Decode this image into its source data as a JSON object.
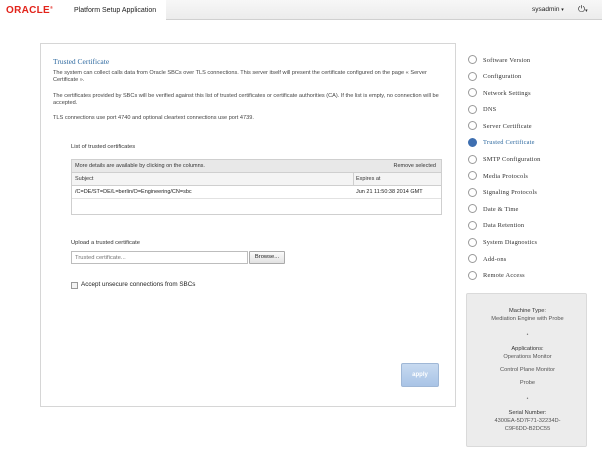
{
  "header": {
    "logo": "ORACLE",
    "logo_mark": "®",
    "app_title": "Platform Setup Application",
    "user": "sysadmin",
    "user_caret": "▾",
    "power_icon": "⏻",
    "power_caret": "▾"
  },
  "panel": {
    "title": "Trusted Certificate",
    "para1": "The system can collect calls data from Oracle SBCs over TLS connections. This server itself will present the certificate configured on the page « Server Certificate ».",
    "para2": "The certificates provided by SBCs will be verified against this list of trusted certificates or certificate authorities (CA). If the list is empty, no connection will be accepted.",
    "para3": "TLS connections use port 4740 and optional cleartext connections use port 4739.",
    "list_label": "List of trusted certificates",
    "table": {
      "hint": "More details are available by clicking on the columns.",
      "remove_label": "Remove selected",
      "columns": [
        "Subject",
        "Expires at"
      ],
      "rows": [
        {
          "subject": "/C=DE/ST=DE/L=berlin/O=Engineering/CN=sbc",
          "expires": "Jun 21 11:50:38 2014 GMT"
        }
      ]
    },
    "upload_label": "Upload a trusted certificate",
    "upload_placeholder": "Trusted certificate...",
    "browse_label": "Browse...",
    "checkbox_label": "Accept unsecure connections from SBCs",
    "apply_label": "apply"
  },
  "nav": {
    "items": [
      {
        "label": "Software Version"
      },
      {
        "label": "Configuration"
      },
      {
        "label": "Network Settings"
      },
      {
        "label": "DNS"
      },
      {
        "label": "Server Certificate"
      },
      {
        "label": "Trusted Certificate",
        "active": true
      },
      {
        "label": "SMTP Configuration"
      },
      {
        "label": "Media Protocols"
      },
      {
        "label": "Signaling Protocols"
      },
      {
        "label": "Date & Time"
      },
      {
        "label": "Data Retention"
      },
      {
        "label": "System Diagnostics"
      },
      {
        "label": "Add-ons"
      },
      {
        "label": "Remote Access"
      }
    ]
  },
  "info": {
    "machine_type_label": "Machine Type:",
    "machine_type_value": "Mediation Engine with Probe",
    "separator": "•",
    "applications_label": "Applications:",
    "app1": "Operations Monitor",
    "app2": "Control Plane Monitor",
    "app3": "Probe",
    "serial_label": "Serial Number:",
    "serial_line1": "4300EA-5D7F71-32234D-",
    "serial_line2": "C9F6DD-B2DC55"
  },
  "colors": {
    "brand_red": "#e2231a",
    "accent_blue": "#3e6fb0",
    "title_blue": "#2f6aa0"
  }
}
